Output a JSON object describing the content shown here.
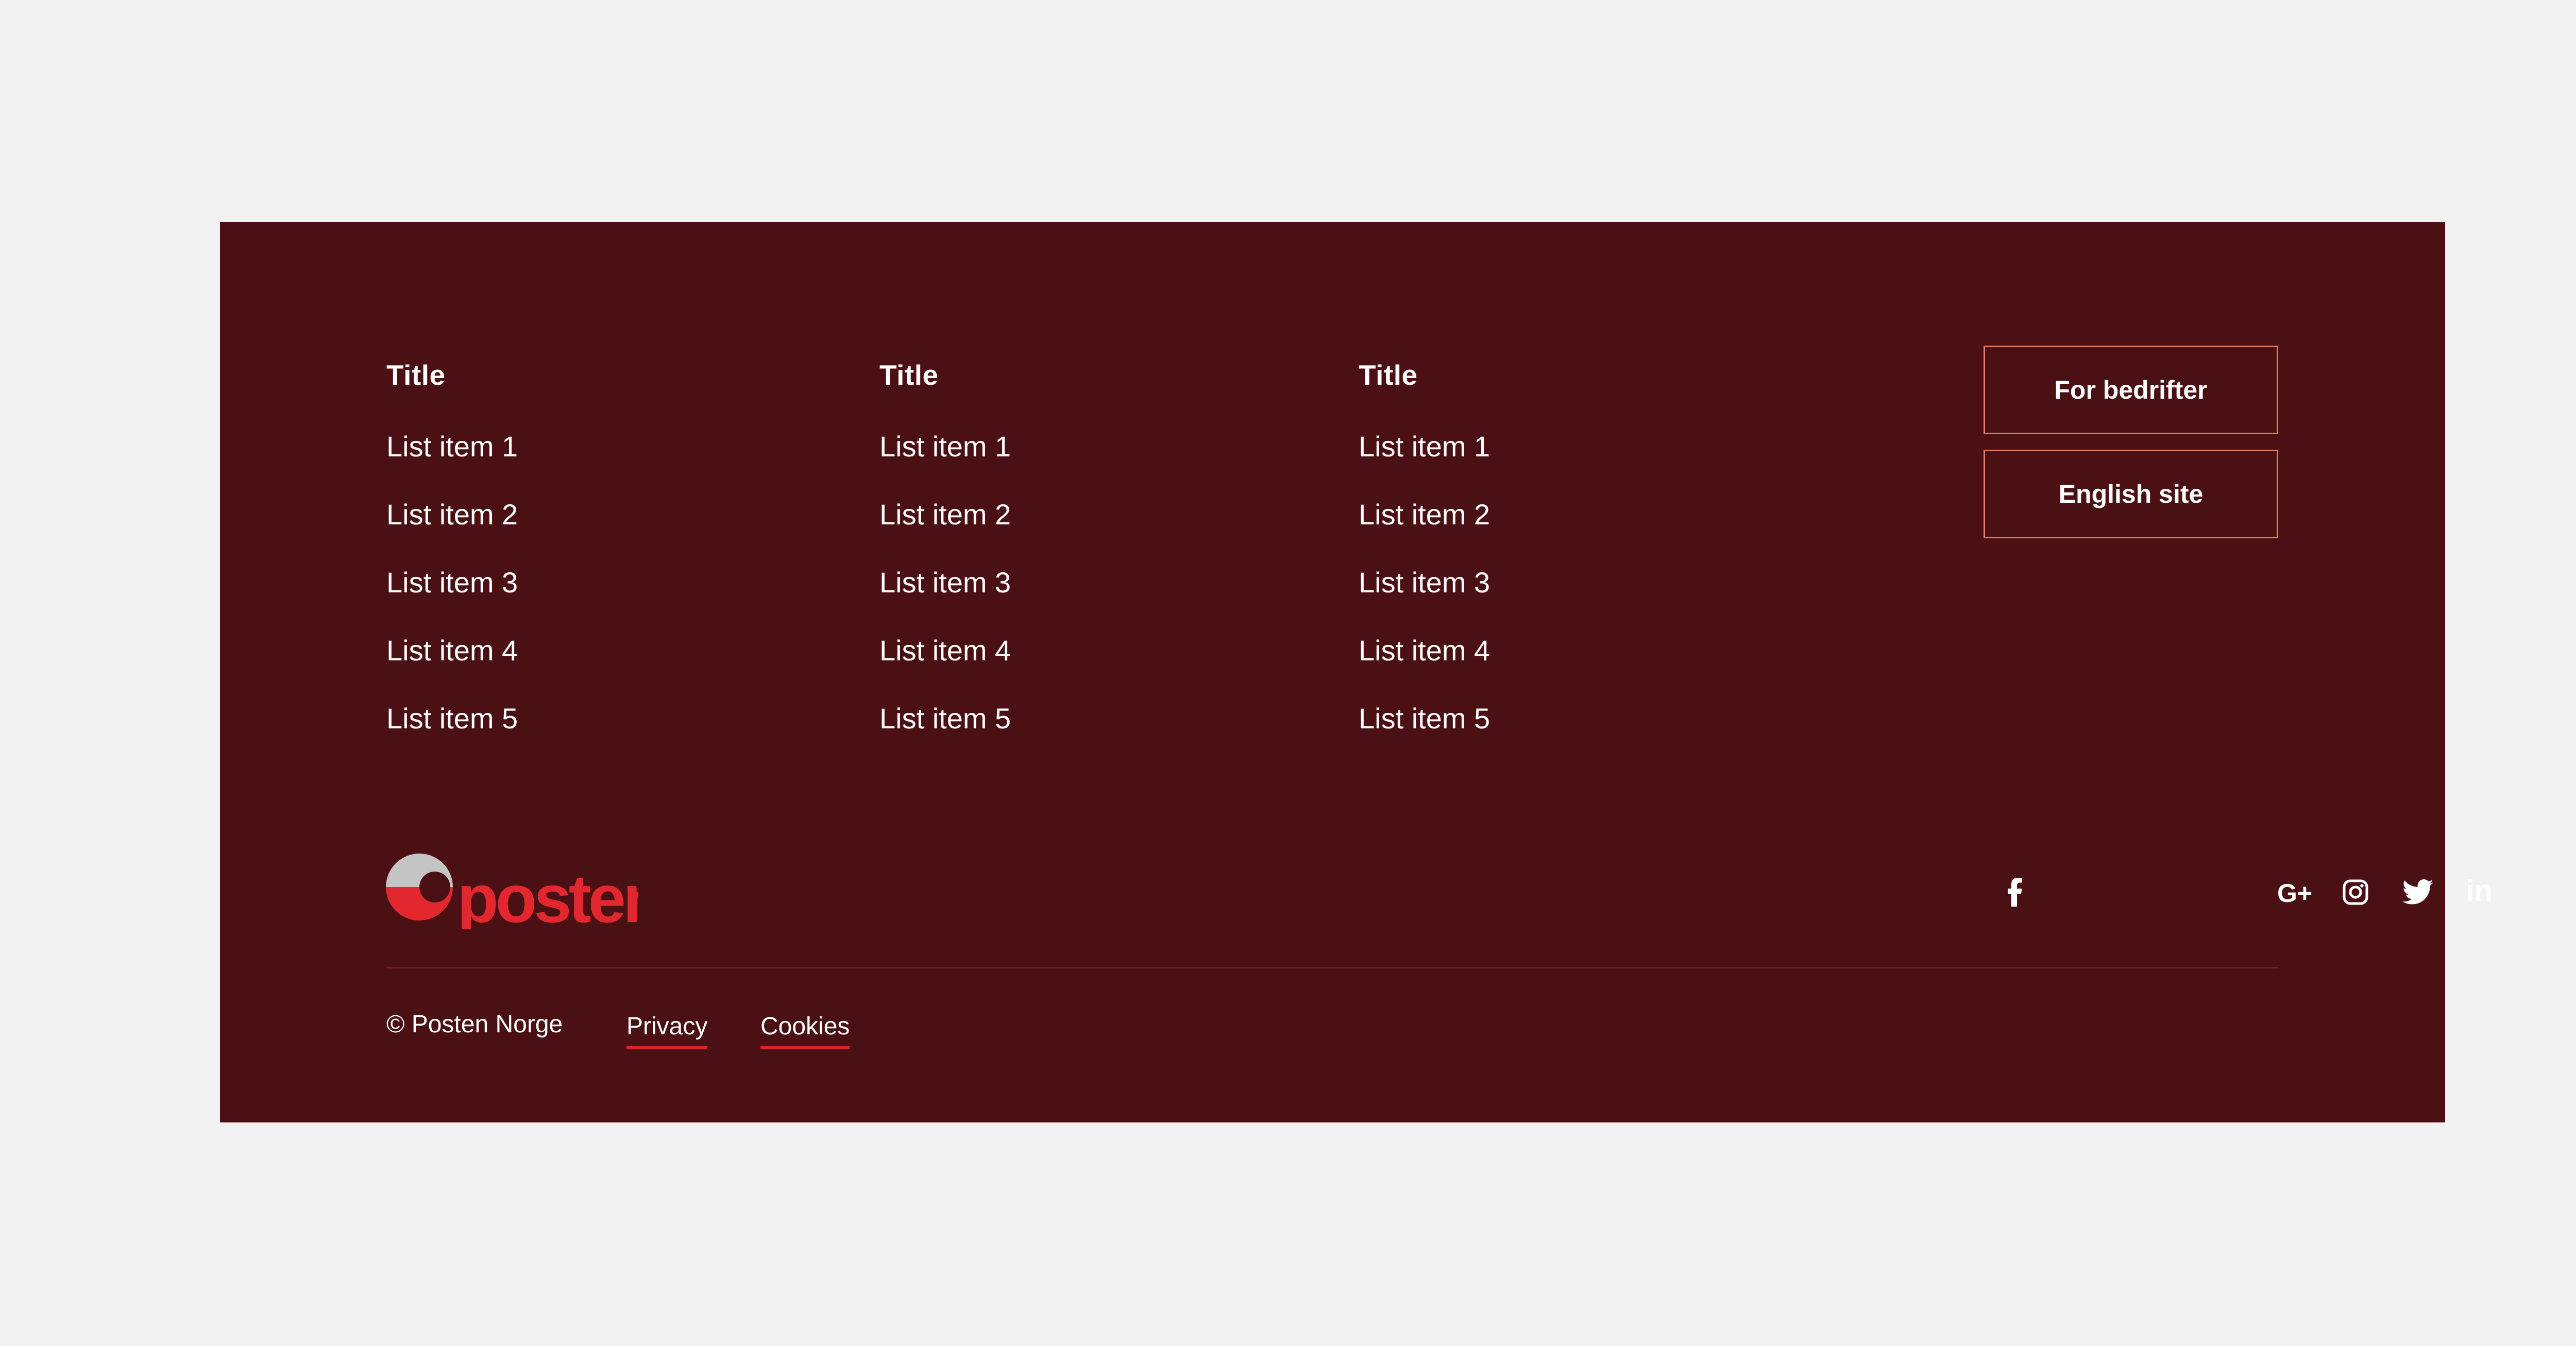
{
  "colors": {
    "page_background": "#f2f2f2",
    "footer_background": "#4a1013",
    "button_border": "#e07b67",
    "brand_red": "#e2282e",
    "logo_grey": "#c4c4c4",
    "link_underline": "#d8262b"
  },
  "columns": [
    {
      "title": "Title",
      "items": [
        "List item 1",
        "List item 2",
        "List item 3",
        "List item 4",
        "List item 5"
      ]
    },
    {
      "title": "Title",
      "items": [
        "List item 1",
        "List item 2",
        "List item 3",
        "List item 4",
        "List item 5"
      ]
    },
    {
      "title": "Title",
      "items": [
        "List item 1",
        "List item 2",
        "List item 3",
        "List item 4",
        "List item 5"
      ]
    }
  ],
  "buttons": {
    "business_label": "For bedrifter",
    "english_label": "English site"
  },
  "logo": {
    "wordmark": "posten",
    "icon": "posten-ring-logo"
  },
  "social": [
    {
      "icon": "facebook-icon"
    },
    {
      "icon": "google-plus-icon",
      "glyph": "G+"
    },
    {
      "icon": "instagram-icon"
    },
    {
      "icon": "twitter-icon"
    },
    {
      "icon": "linkedin-icon",
      "glyph": "in"
    }
  ],
  "legal": {
    "copyright": "© Posten Norge",
    "privacy_label": "Privacy",
    "cookies_label": "Cookies"
  }
}
